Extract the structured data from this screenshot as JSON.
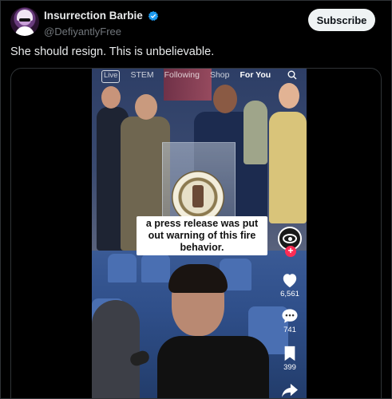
{
  "author": {
    "display_name": "Insurrection Barbie",
    "handle": "@DefiyantlyFree",
    "verified": true
  },
  "subscribe_label": "Subscribe",
  "tweet_text": "She should resign. This is unbelievable.",
  "video": {
    "tabs": [
      "Live",
      "STEM",
      "Following",
      "Shop",
      "For You"
    ],
    "active_tab": "For You",
    "caption": "a press release was put out warning of this fire behavior.",
    "stats": {
      "likes": "6,561",
      "comments": "741",
      "bookmarks": "399"
    }
  },
  "colors": {
    "background": "#000000",
    "text": "#e7e9ea",
    "muted": "#71767b",
    "verified_blue": "#1d9bf0",
    "follow_red": "#fe2c55"
  },
  "icons": [
    "verified-badge-icon",
    "search-icon",
    "heart-icon",
    "comment-icon",
    "bookmark-icon",
    "share-icon",
    "plus-icon"
  ]
}
